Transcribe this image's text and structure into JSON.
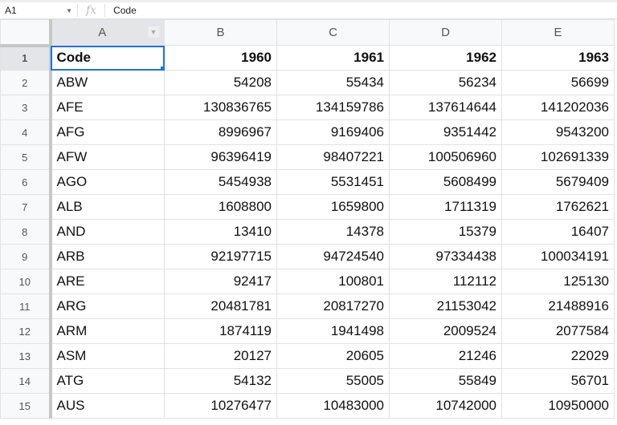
{
  "formula_bar": {
    "cell_ref": "A1",
    "fx_label": "fx",
    "value": "Code"
  },
  "columns": [
    "A",
    "B",
    "C",
    "D",
    "E"
  ],
  "rows": [
    [
      "Code",
      "1960",
      "1961",
      "1962",
      "1963"
    ],
    [
      "ABW",
      "54208",
      "55434",
      "56234",
      "56699"
    ],
    [
      "AFE",
      "130836765",
      "134159786",
      "137614644",
      "141202036"
    ],
    [
      "AFG",
      "8996967",
      "9169406",
      "9351442",
      "9543200"
    ],
    [
      "AFW",
      "96396419",
      "98407221",
      "100506960",
      "102691339"
    ],
    [
      "AGO",
      "5454938",
      "5531451",
      "5608499",
      "5679409"
    ],
    [
      "ALB",
      "1608800",
      "1659800",
      "1711319",
      "1762621"
    ],
    [
      "AND",
      "13410",
      "14378",
      "15379",
      "16407"
    ],
    [
      "ARB",
      "92197715",
      "94724540",
      "97334438",
      "100034191"
    ],
    [
      "ARE",
      "92417",
      "100801",
      "112112",
      "125130"
    ],
    [
      "ARG",
      "20481781",
      "20817270",
      "21153042",
      "21488916"
    ],
    [
      "ARM",
      "1874119",
      "1941498",
      "2009524",
      "2077584"
    ],
    [
      "ASM",
      "20127",
      "20605",
      "21246",
      "22029"
    ],
    [
      "ATG",
      "54132",
      "55005",
      "55849",
      "56701"
    ],
    [
      "AUS",
      "10276477",
      "10483000",
      "10742000",
      "10950000"
    ]
  ]
}
